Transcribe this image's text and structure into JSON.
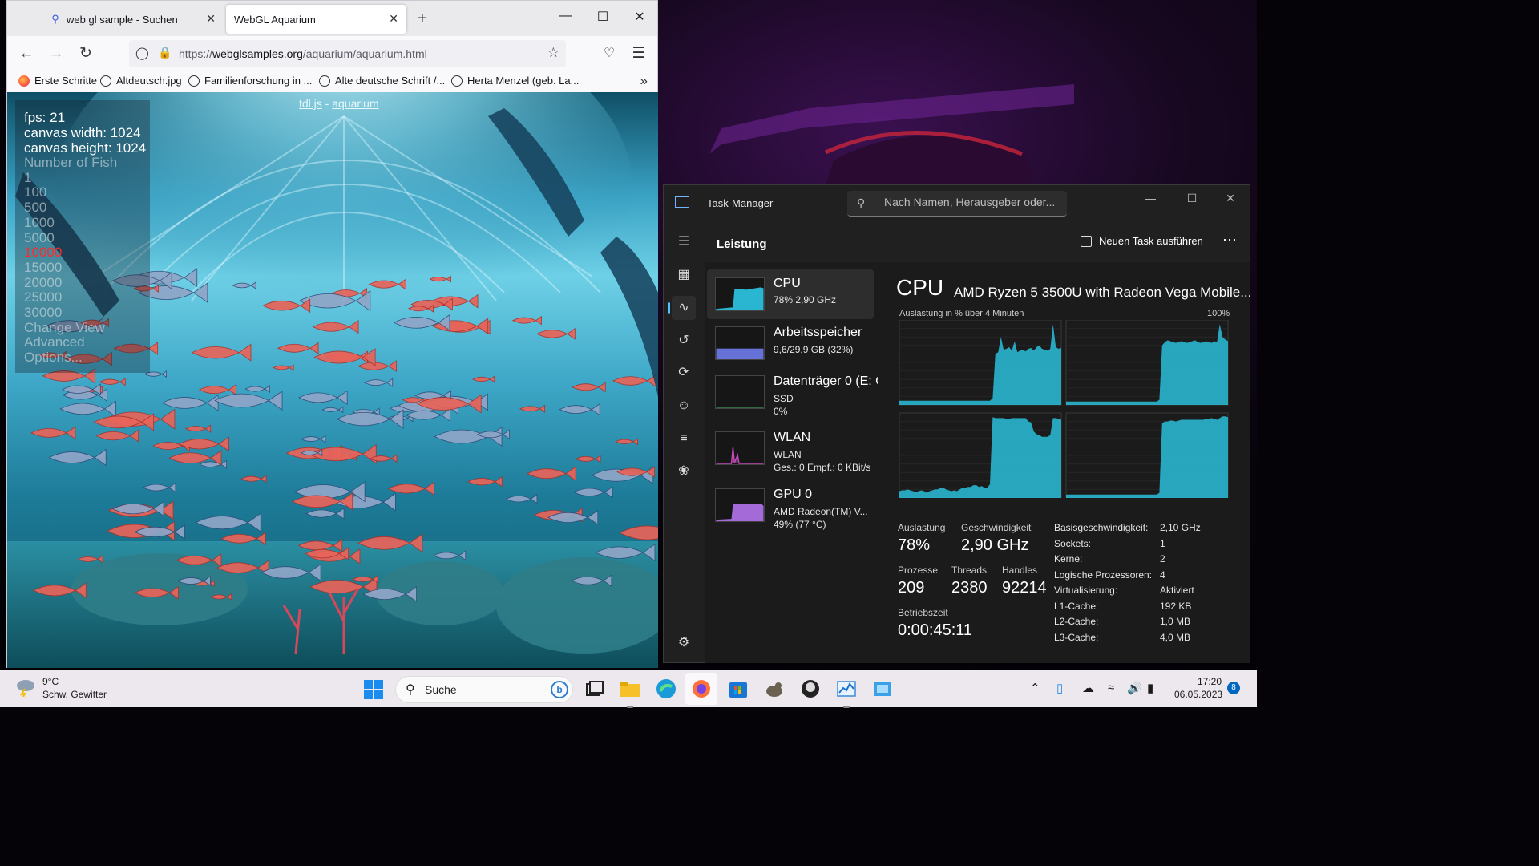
{
  "browser": {
    "tabs": [
      {
        "label": "web gl sample - Suchen",
        "active": false
      },
      {
        "label": "WebGL Aquarium",
        "active": true
      }
    ],
    "url": {
      "scheme": "https://",
      "host": "webglsamples.org",
      "path": "/aquarium/aquarium.html"
    },
    "bookmarks": [
      "Erste Schritte",
      "Altdeutsch.jpg",
      "Familienforschung in ...",
      "Alte deutsche Schrift /...",
      "Herta Menzel (geb. La..."
    ]
  },
  "aquarium": {
    "header_link1": "tdl.js",
    "header_sep": " - ",
    "header_link2": "aquarium",
    "fps": "fps: 21",
    "canvas_width": "canvas width: 1024",
    "canvas_height": "canvas height: 1024",
    "menu_title": "Number of Fish",
    "fish_options": [
      "1",
      "100",
      "500",
      "1000",
      "5000",
      "10000",
      "15000",
      "20000",
      "25000",
      "30000"
    ],
    "selected_fish": "10000",
    "links": [
      "Change View",
      "Advanced",
      "Options..."
    ]
  },
  "taskmanager": {
    "title": "Task-Manager",
    "search_placeholder": "Nach Namen, Herausgeber oder...",
    "section": "Leistung",
    "new_task": "Neuen Task ausführen",
    "resources": [
      {
        "name": "CPU",
        "sub1": "78%  2,90 GHz",
        "sub2": "",
        "color": "#2ab6d0"
      },
      {
        "name": "Arbeitsspeicher",
        "sub1": "9,6/29,9 GB (32%)",
        "sub2": "",
        "color": "#7a84e8"
      },
      {
        "name": "Datenträger 0 (E: C",
        "sub1": "SSD",
        "sub2": "0%",
        "color": "#4fb86a"
      },
      {
        "name": "WLAN",
        "sub1": "WLAN",
        "sub2": "Ges.: 0  Empf.: 0 KBit/s",
        "color": "#c44ab8"
      },
      {
        "name": "GPU 0",
        "sub1": "AMD Radeon(TM) V...",
        "sub2": "49%  (77 °C)",
        "color": "#a46ad8"
      }
    ],
    "cpu": {
      "title": "CPU",
      "model": "AMD Ryzen 5 3500U with Radeon Vega Mobile...",
      "graph_label": "Auslastung in % über 4 Minuten",
      "graph_max": "100%",
      "stats": {
        "util_label": "Auslastung",
        "util": "78%",
        "speed_label": "Geschwindigkeit",
        "speed": "2,90 GHz",
        "proc_label": "Prozesse",
        "proc": "209",
        "threads_label": "Threads",
        "threads": "2380",
        "handles_label": "Handles",
        "handles": "92214",
        "uptime_label": "Betriebszeit",
        "uptime": "0:00:45:11"
      },
      "info": [
        {
          "k": "Basisgeschwindigkeit:",
          "v": "2,10 GHz"
        },
        {
          "k": "Sockets:",
          "v": "1"
        },
        {
          "k": "Kerne:",
          "v": "2"
        },
        {
          "k": "Logische Prozessoren:",
          "v": "4"
        },
        {
          "k": "Virtualisierung:",
          "v": "Aktiviert"
        },
        {
          "k": "L1-Cache:",
          "v": "192 KB"
        },
        {
          "k": "L2-Cache:",
          "v": "1,0 MB"
        },
        {
          "k": "L3-Cache:",
          "v": "4,0 MB"
        }
      ],
      "core_graphs": [
        [
          5,
          5,
          5,
          5,
          5,
          5,
          5,
          5,
          5,
          5,
          5,
          5,
          5,
          5,
          5,
          5,
          5,
          5,
          5,
          5,
          5,
          5,
          5,
          5,
          5,
          5,
          5,
          5,
          5,
          5,
          5,
          5,
          5,
          5,
          8,
          60,
          62,
          80,
          65,
          66,
          68,
          64,
          75,
          62,
          64,
          65,
          63,
          66,
          67,
          64,
          68,
          70,
          66,
          65,
          64,
          66,
          95,
          68,
          66,
          67
        ],
        [
          4,
          4,
          4,
          4,
          4,
          4,
          4,
          4,
          4,
          4,
          4,
          4,
          4,
          4,
          4,
          4,
          4,
          4,
          4,
          4,
          4,
          4,
          4,
          4,
          4,
          4,
          4,
          4,
          4,
          4,
          4,
          4,
          4,
          4,
          6,
          70,
          74,
          76,
          75,
          74,
          73,
          74,
          75,
          74,
          73,
          74,
          75,
          76,
          74,
          73,
          74,
          75,
          74,
          73,
          75,
          74,
          95,
          80,
          77,
          75
        ],
        [
          8,
          9,
          9,
          10,
          9,
          8,
          7,
          8,
          9,
          8,
          6,
          8,
          9,
          10,
          10,
          12,
          12,
          10,
          9,
          8,
          9,
          8,
          10,
          12,
          12,
          13,
          13,
          15,
          15,
          13,
          14,
          12,
          12,
          16,
          95,
          94,
          94,
          94,
          94,
          93,
          93,
          94,
          94,
          94,
          94,
          94,
          94,
          90,
          89,
          78,
          75,
          74,
          72,
          72,
          72,
          74,
          94,
          94,
          93,
          92
        ],
        [
          4,
          4,
          4,
          4,
          4,
          4,
          4,
          4,
          4,
          4,
          4,
          4,
          4,
          4,
          4,
          4,
          4,
          4,
          4,
          4,
          4,
          4,
          4,
          4,
          4,
          4,
          4,
          4,
          4,
          4,
          4,
          4,
          4,
          4,
          6,
          88,
          90,
          90,
          91,
          91,
          90,
          91,
          92,
          92,
          92,
          92,
          92,
          92,
          92,
          92,
          92,
          93,
          93,
          94,
          93,
          92,
          94,
          96,
          96,
          95
        ]
      ]
    }
  },
  "taskbar": {
    "weather_temp": "9°C",
    "weather_desc": "Schw. Gewitter",
    "search_label": "Suche",
    "time": "17:20",
    "date": "06.05.2023",
    "notifications": "8"
  }
}
